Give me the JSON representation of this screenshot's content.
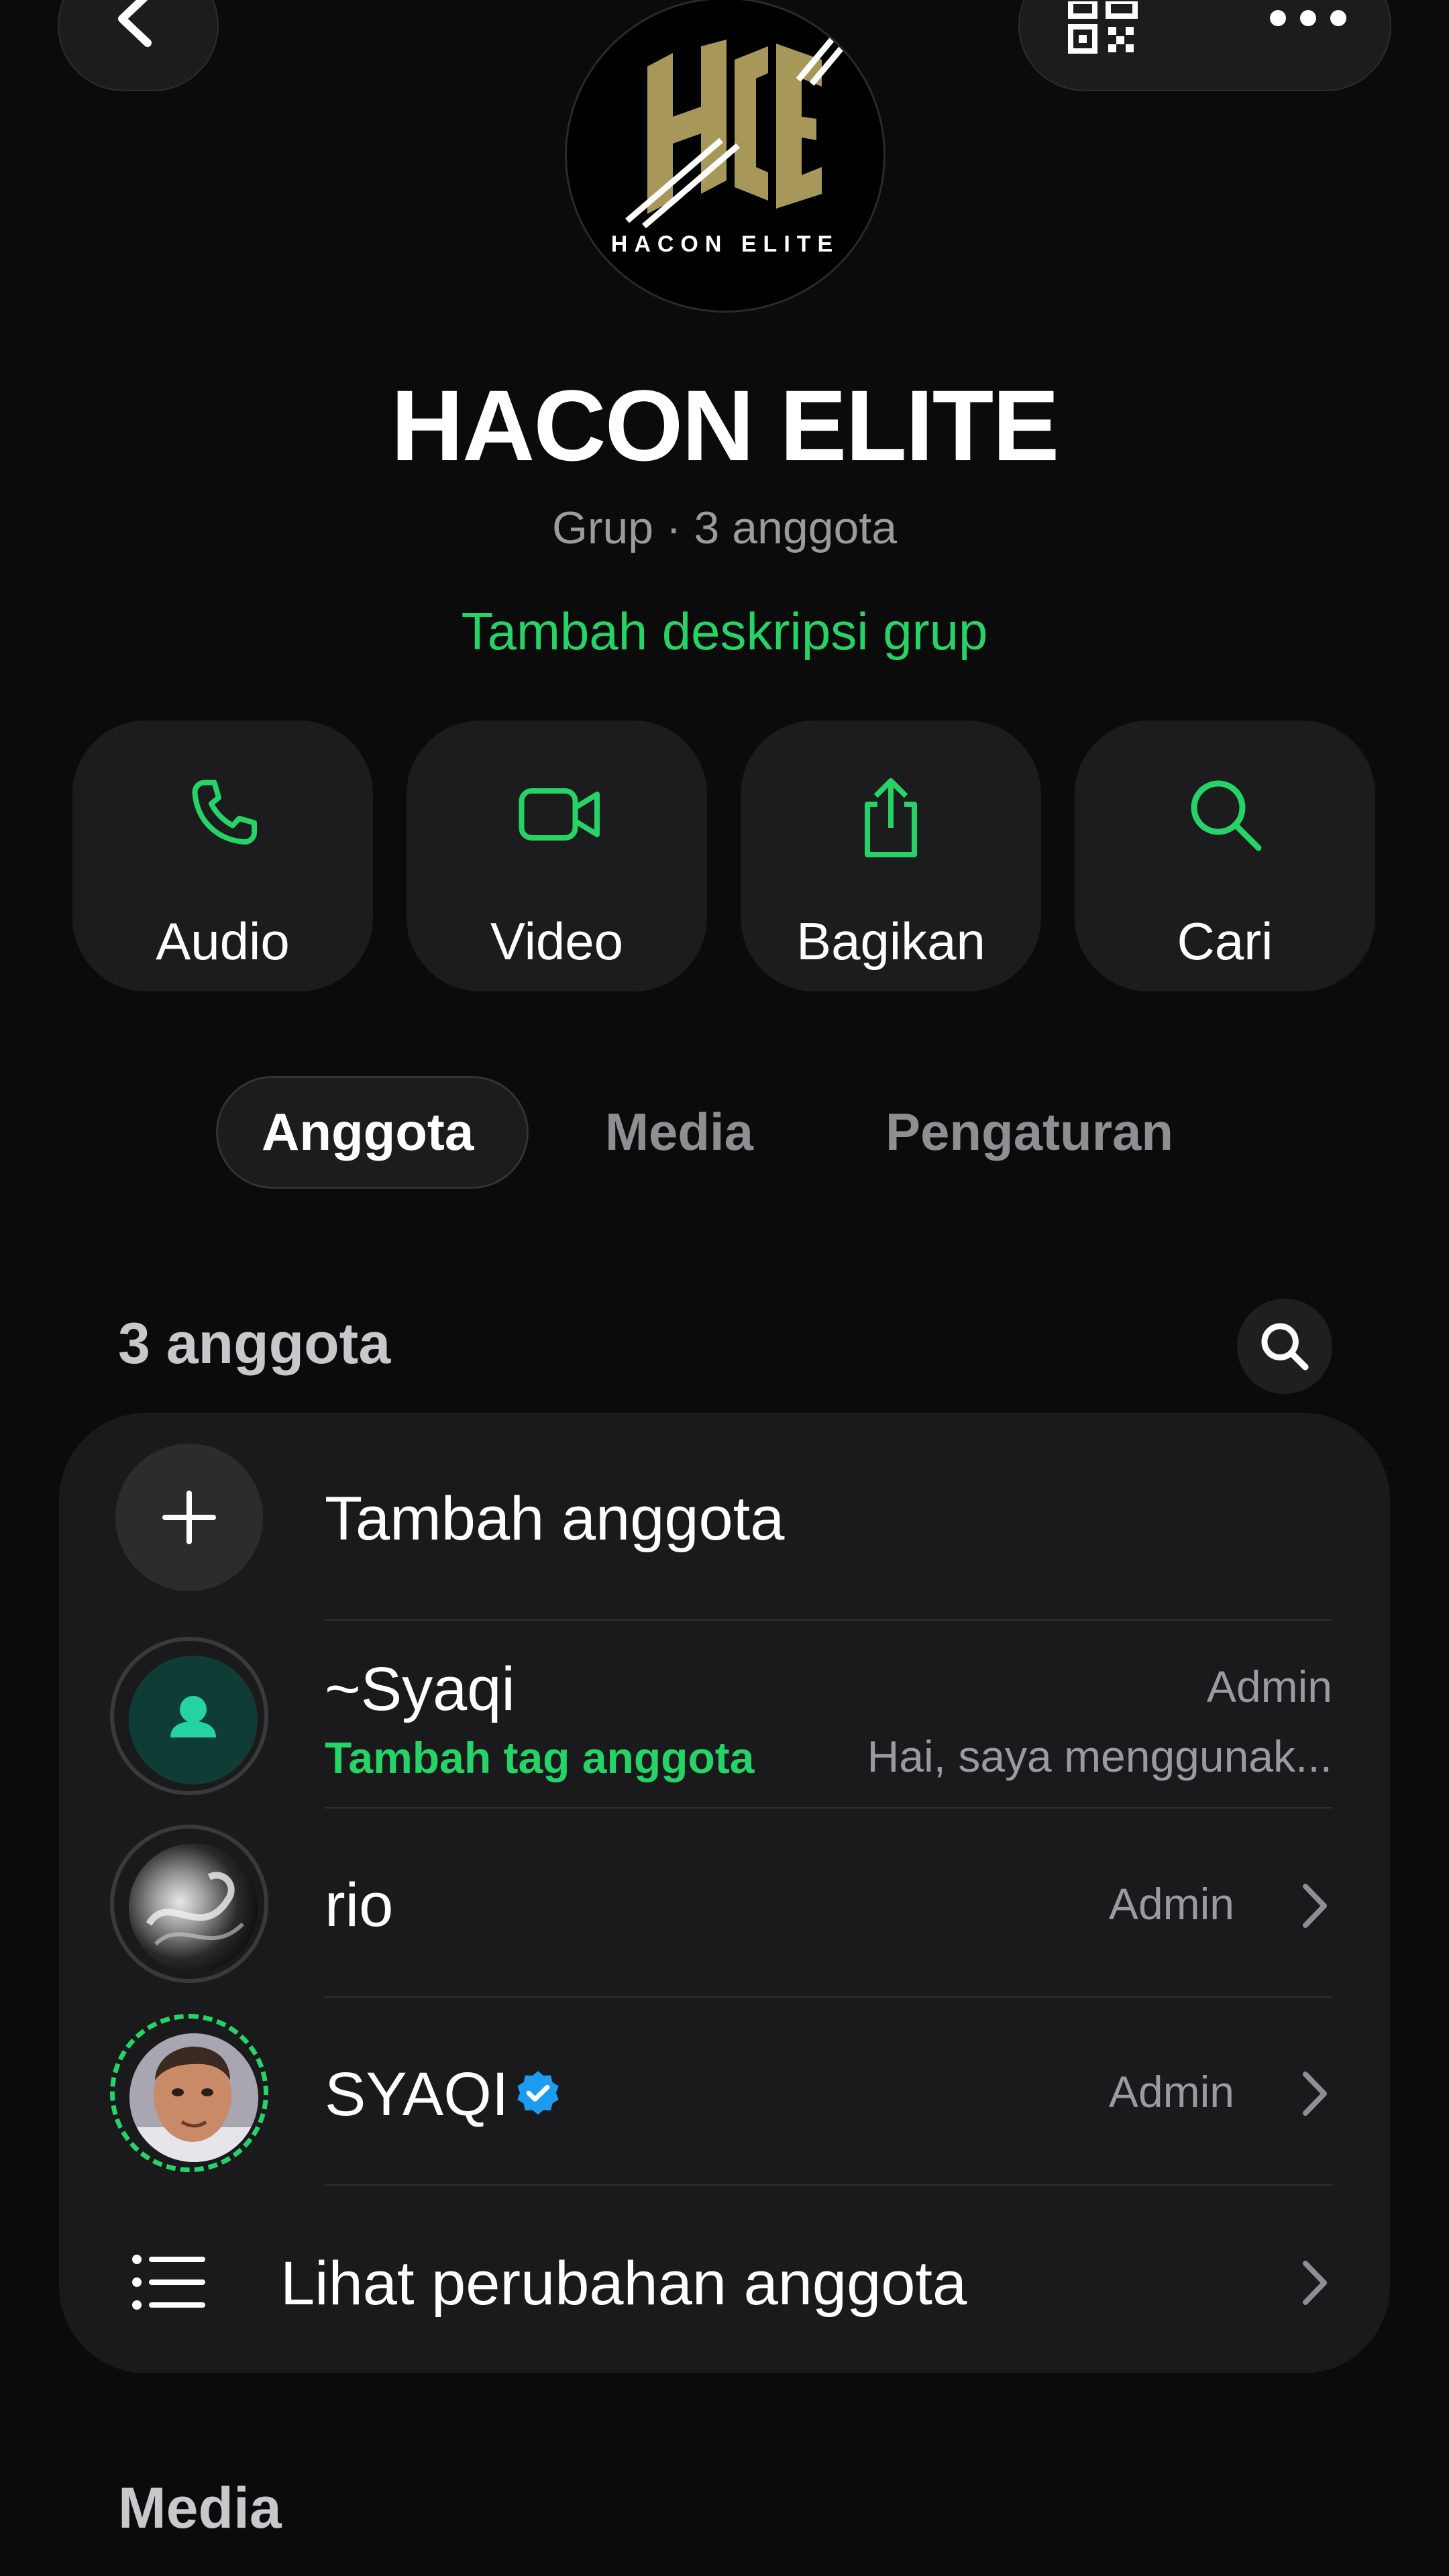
{
  "top_bar": {
    "back": "chevron-left-icon",
    "qr": "qr-code-icon",
    "more": "more-horizontal-icon"
  },
  "group": {
    "logo_text": "HACON ELITE",
    "name": "HACON ELITE",
    "subtitle": "Grup · 3 anggota",
    "add_description": "Tambah deskripsi grup"
  },
  "actions": [
    {
      "label": "Audio",
      "icon": "phone-icon"
    },
    {
      "label": "Video",
      "icon": "video-icon"
    },
    {
      "label": "Bagikan",
      "icon": "share-icon"
    },
    {
      "label": "Cari",
      "icon": "search-icon"
    }
  ],
  "tabs": [
    {
      "label": "Anggota",
      "active": true
    },
    {
      "label": "Media",
      "active": false
    },
    {
      "label": "Pengaturan",
      "active": false
    }
  ],
  "members": {
    "count_label": "3 anggota",
    "add_label": "Tambah anggota",
    "list": [
      {
        "name": "~Syaqi",
        "tag": "Tambah tag anggota",
        "status": "Hai, saya menggunak...",
        "role": "Admin"
      },
      {
        "name": "rio",
        "role": "Admin"
      },
      {
        "name": "SYAQI",
        "verified": true,
        "role": "Admin"
      }
    ],
    "view_changes_label": "Lihat perubahan anggota"
  },
  "media_heading": "Media",
  "colors": {
    "accent": "#25d366",
    "background": "#0b0b0b",
    "card": "#1a1a1c",
    "verified": "#1d9bf0"
  }
}
